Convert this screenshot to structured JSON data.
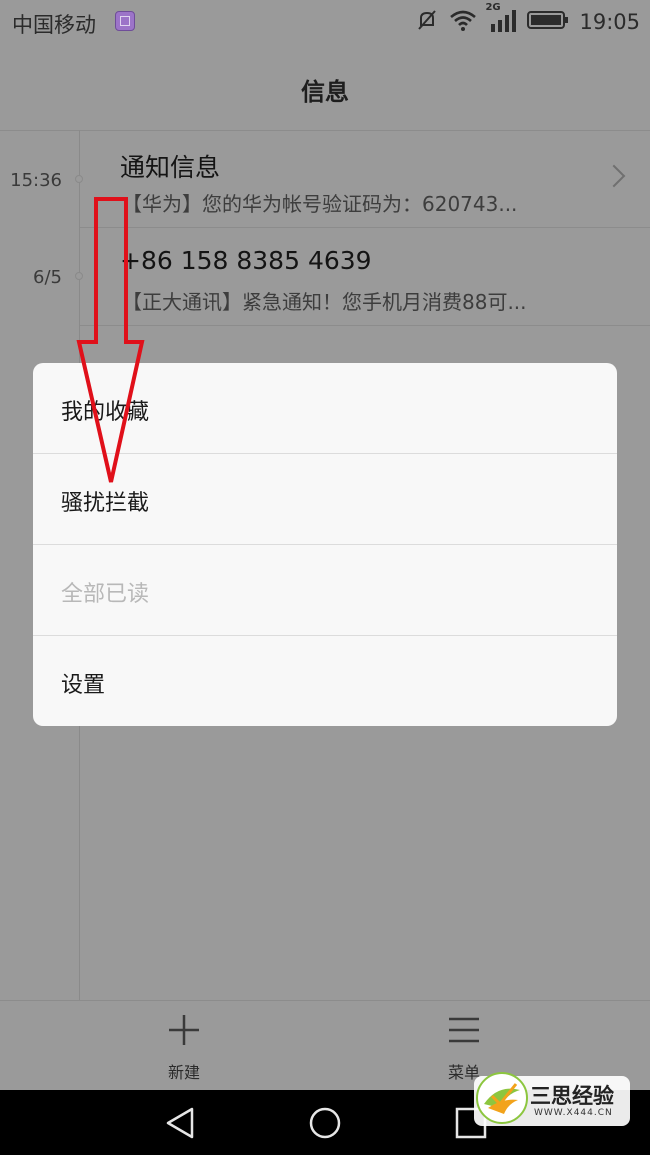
{
  "status_bar": {
    "carrier": "中国移动",
    "network_type": "2G",
    "time": "19:05"
  },
  "header": {
    "title": "信息"
  },
  "conversations": [
    {
      "time": "15:36",
      "title": "通知信息",
      "preview": "【华为】您的华为帐号验证码为：620743..."
    },
    {
      "time": "6/5",
      "title": "+86 158 8385 4639",
      "preview": "【正大通讯】紧急通知！您手机月消费88可..."
    }
  ],
  "menu": {
    "items": [
      {
        "label": "我的收藏",
        "enabled": true
      },
      {
        "label": "骚扰拦截",
        "enabled": true
      },
      {
        "label": "全部已读",
        "enabled": false
      },
      {
        "label": "设置",
        "enabled": true
      }
    ]
  },
  "toolbar": {
    "new_label": "新建",
    "menu_label": "菜单"
  },
  "watermark": {
    "title": "三思经验",
    "url": "WWW.X444.CN"
  },
  "colors": {
    "dim_background": "#9a9a9a",
    "menu_background": "#f8f8f8",
    "disabled_text": "#b8b8b8",
    "arrow_red": "#e0101a",
    "nav_bar": "#000000"
  },
  "icons": {
    "status": [
      "screenshot-icon",
      "mute-icon",
      "wifi-icon",
      "signal-icon",
      "battery-icon"
    ],
    "toolbar": [
      "plus-icon",
      "menu-icon"
    ],
    "nav": [
      "back-icon",
      "home-icon",
      "recents-icon"
    ],
    "row": [
      "chevron-right-icon"
    ]
  }
}
